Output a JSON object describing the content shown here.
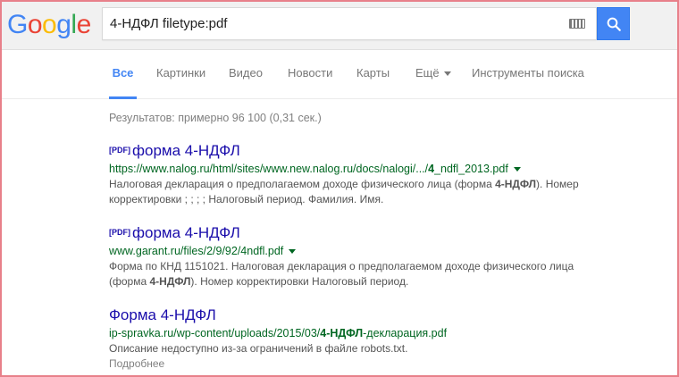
{
  "header": {
    "logo_letters": [
      {
        "ch": "G",
        "color": "#4285f4"
      },
      {
        "ch": "o",
        "color": "#ea4335"
      },
      {
        "ch": "o",
        "color": "#fbbc05"
      },
      {
        "ch": "g",
        "color": "#4285f4"
      },
      {
        "ch": "l",
        "color": "#34a853"
      },
      {
        "ch": "e",
        "color": "#ea4335"
      }
    ],
    "search_value": "4-НДФЛ filetype:pdf",
    "keyboard_icon": "keyboard-icon",
    "search_icon": "search-icon"
  },
  "tabs": [
    {
      "label": "Все",
      "active": true
    },
    {
      "label": "Картинки",
      "active": false
    },
    {
      "label": "Видео",
      "active": false
    },
    {
      "label": "Новости",
      "active": false
    },
    {
      "label": "Карты",
      "active": false
    },
    {
      "label": "Ещё",
      "active": false,
      "dropdown": true
    },
    {
      "label": "Инструменты поиска",
      "active": false
    }
  ],
  "stats": "Результатов: примерно 96 100 (0,31 сек.)",
  "results": [
    {
      "tag": "[PDF]",
      "title": "форма 4-НДФЛ",
      "url_parts": [
        "https://www.nalog.ru/html/sites/www.new.nalog.ru/docs/nalogi/.../",
        "4",
        "_ndfl_2013.pdf"
      ],
      "url_caret": true,
      "snippet_lines": [
        [
          "Налоговая декларация о предполагаемом доходе физического лица (форма ",
          "4-НДФЛ",
          "). Номер"
        ],
        [
          "корректировки ; ; ; ; Налоговый период. Фамилия. Имя.",
          "",
          ""
        ]
      ]
    },
    {
      "tag": "[PDF]",
      "title": "форма 4-НДФЛ",
      "url_parts": [
        "www.garant.ru/files/2/9/92/4ndfl.pdf",
        "",
        ""
      ],
      "url_caret": true,
      "snippet_lines": [
        [
          "Форма по КНД 1151021. Налоговая декларация о предполагаемом доходе физического лица",
          "",
          ""
        ],
        [
          "(форма ",
          "4-НДФЛ",
          "). Номер корректировки Налоговый период."
        ]
      ]
    },
    {
      "tag": "",
      "title": "Форма 4-НДФЛ",
      "url_parts": [
        "ip-spravka.ru/wp-content/uploads/2015/03/",
        "4-НДФЛ",
        "-декларация.pdf"
      ],
      "url_caret": false,
      "snippet_lines": [
        [
          "Описание недоступно из-за ограничений в файле robots.txt.",
          "",
          ""
        ]
      ],
      "more": "Подробнее"
    }
  ]
}
